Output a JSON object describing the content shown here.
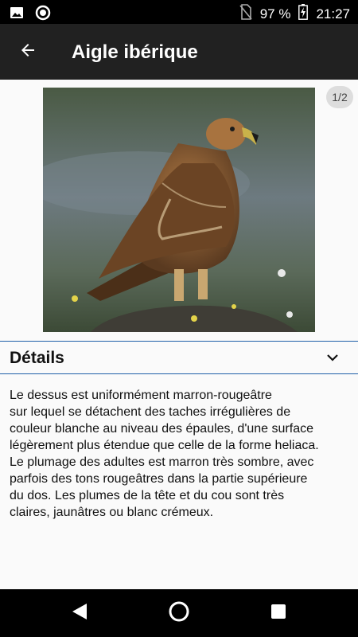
{
  "status_bar": {
    "battery": "97 %",
    "time": "21:27",
    "icons": [
      "image-icon",
      "record-icon",
      "no-sim-icon",
      "battery-charging-icon"
    ]
  },
  "app_bar": {
    "title": "Aigle ibérique",
    "back_icon": "arrow-back-icon"
  },
  "gallery": {
    "counter": "1/2",
    "image_description": "bird-photo"
  },
  "details": {
    "title": "Détails",
    "toggle_icon": "chevron-down-icon",
    "text": "Le dessus est uniformément marron-rougeâtre\nsur lequel se détachent des taches irrégulières de\ncouleur blanche au niveau des épaules, d'une surface\nlégèrement plus étendue que celle de la forme heliaca.\nLe plumage des adultes est marron très sombre, avec\nparfois des tons rougeâtres dans la partie supérieure\ndu dos. Les plumes de la tête et du cou sont très\nclaires, jaunâtres ou blanc crémeux."
  },
  "nav_bar": {
    "buttons": [
      "back-triangle-icon",
      "home-circle-icon",
      "recents-square-icon"
    ]
  },
  "colors": {
    "app_bar": "#212121",
    "accent_divider": "#1f5fa8",
    "background": "#fafafa"
  }
}
